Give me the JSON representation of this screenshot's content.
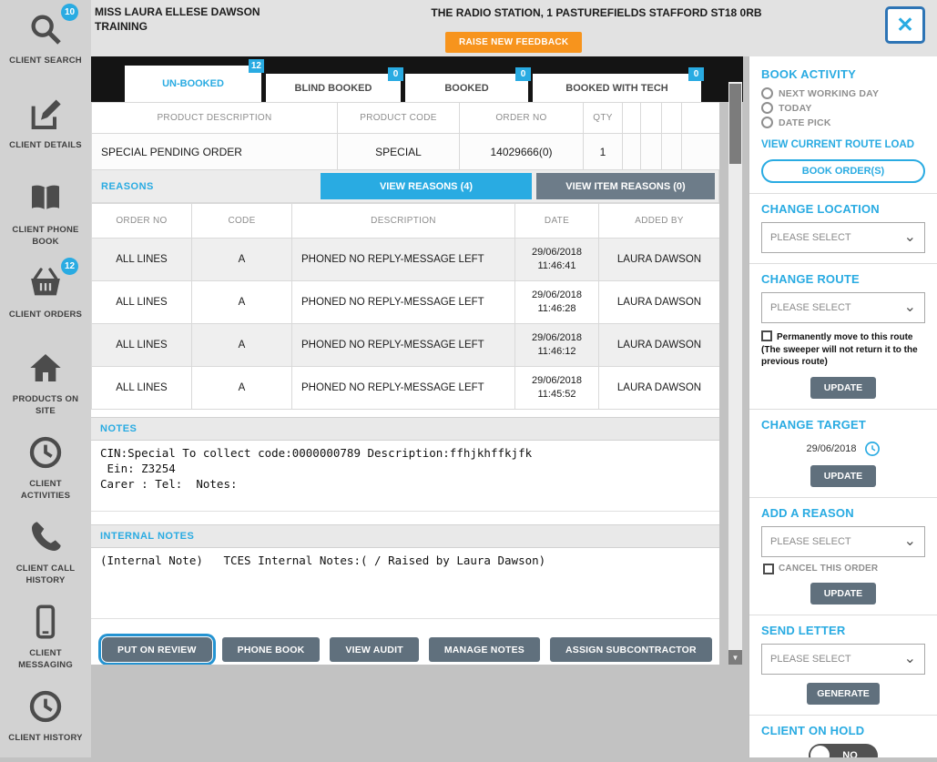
{
  "icons": {
    "close": "✕",
    "chevron_down": "⌄",
    "scroll_down": "▼"
  },
  "colors": {
    "accent": "#29abe2",
    "orange": "#f7941d",
    "slate": "#60707d"
  },
  "header": {
    "client_name": "MISS LAURA ELLESE DAWSON",
    "client_subtitle": "TRAINING",
    "address": "THE RADIO STATION, 1 PASTUREFIELDS STAFFORD ST18 0RB",
    "raise_feedback": "RAISE NEW FEEDBACK"
  },
  "sidebar": {
    "items": [
      {
        "label": "CLIENT SEARCH",
        "badge": "10"
      },
      {
        "label": "CLIENT DETAILS"
      },
      {
        "label": "CLIENT PHONE BOOK"
      },
      {
        "label": "CLIENT ORDERS",
        "badge": "12"
      },
      {
        "label": "PRODUCTS ON SITE"
      },
      {
        "label": "CLIENT ACTIVITIES"
      },
      {
        "label": "CLIENT CALL HISTORY"
      },
      {
        "label": "CLIENT MESSAGING"
      },
      {
        "label": "CLIENT HISTORY"
      }
    ]
  },
  "tabs": [
    {
      "label": "UN-BOOKED",
      "badge": "12"
    },
    {
      "label": "BLIND BOOKED",
      "badge": "0"
    },
    {
      "label": "BOOKED",
      "badge": "0"
    },
    {
      "label": "BOOKED WITH TECH",
      "badge": "0"
    }
  ],
  "orders": {
    "headers": [
      "PRODUCT DESCRIPTION",
      "PRODUCT CODE",
      "ORDER NO",
      "QTY"
    ],
    "row": {
      "description": "SPECIAL PENDING ORDER",
      "code": "SPECIAL",
      "order_no": "14029666(0)",
      "qty": "1"
    }
  },
  "reasons": {
    "section_label": "REASONS",
    "view_reasons": "VIEW REASONS (4)",
    "view_item_reasons": "VIEW ITEM REASONS (0)",
    "headers": [
      "ORDER NO",
      "CODE",
      "DESCRIPTION",
      "DATE",
      "ADDED BY"
    ],
    "rows": [
      {
        "order_no": "ALL LINES",
        "code": "A",
        "description": "PHONED NO REPLY-MESSAGE LEFT",
        "date": "29/06/2018",
        "time": "11:46:41",
        "added_by": "LAURA DAWSON"
      },
      {
        "order_no": "ALL LINES",
        "code": "A",
        "description": "PHONED NO REPLY-MESSAGE LEFT",
        "date": "29/06/2018",
        "time": "11:46:28",
        "added_by": "LAURA DAWSON"
      },
      {
        "order_no": "ALL LINES",
        "code": "A",
        "description": "PHONED NO REPLY-MESSAGE LEFT",
        "date": "29/06/2018",
        "time": "11:46:12",
        "added_by": "LAURA DAWSON"
      },
      {
        "order_no": "ALL LINES",
        "code": "A",
        "description": "PHONED NO REPLY-MESSAGE LEFT",
        "date": "29/06/2018",
        "time": "11:45:52",
        "added_by": "LAURA DAWSON"
      }
    ]
  },
  "notes": {
    "title": "NOTES",
    "lines": [
      "CIN:Special To collect code:0000000789 Description:ffhjkhffkjfk",
      " Ein: Z3254",
      "Carer : Tel:  Notes:"
    ]
  },
  "internal_notes": {
    "title": "INTERNAL NOTES",
    "content": "(Internal Note)   TCES Internal Notes:( / Raised by Laura Dawson)"
  },
  "actions": {
    "put_on_review": "PUT ON REVIEW",
    "phone_book": "PHONE BOOK",
    "view_audit": "VIEW AUDIT",
    "manage_notes": "MANAGE NOTES",
    "assign_subcontractor": "ASSIGN SUBCONTRACTOR"
  },
  "right_panel": {
    "book_activity": {
      "title": "BOOK ACTIVITY",
      "options": [
        "NEXT WORKING DAY",
        "TODAY",
        "DATE PICK"
      ],
      "route_load_link": "VIEW CURRENT ROUTE LOAD",
      "book_button": "BOOK ORDER(S)"
    },
    "change_location": {
      "title": "CHANGE LOCATION",
      "select_value": "PLEASE SELECT"
    },
    "change_route": {
      "title": "CHANGE ROUTE",
      "select_value": "PLEASE SELECT",
      "checkbox_label": "Permanently move to this route (The sweeper will not return it to the previous route)",
      "update_button": "UPDATE"
    },
    "change_target": {
      "title": "CHANGE TARGET",
      "date": "29/06/2018",
      "update_button": "UPDATE"
    },
    "add_reason": {
      "title": "ADD A REASON",
      "select_value": "PLEASE SELECT",
      "cancel_checkbox_label": "CANCEL THIS ORDER",
      "update_button": "UPDATE"
    },
    "send_letter": {
      "title": "SEND LETTER",
      "select_value": "PLEASE SELECT",
      "generate_button": "GENERATE"
    },
    "client_on_hold": {
      "title": "CLIENT ON HOLD",
      "toggle_value": "NO"
    }
  }
}
